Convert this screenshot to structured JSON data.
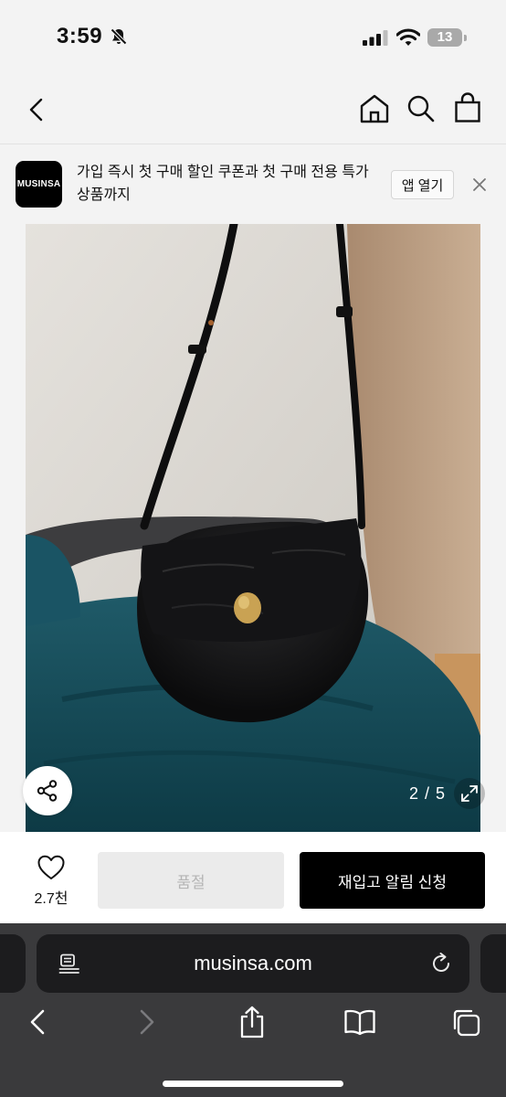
{
  "status_bar": {
    "time": "3:59",
    "battery_level": "13",
    "icons": [
      "bell-slash-icon",
      "cellular-signal-icon",
      "wifi-icon",
      "battery-icon"
    ]
  },
  "nav": {
    "icons": [
      "back-chevron-icon",
      "home-icon",
      "search-icon",
      "shopping-bag-icon"
    ]
  },
  "app_banner": {
    "logo_text": "MUSINSA",
    "promo_text": "가입 즉시 첫 구매 할인 쿠폰과 첫 구매 전용 특가 상품까지",
    "open_app_label": "앱 열기",
    "close_icon": "close-icon"
  },
  "product_image": {
    "counter": "2 / 5",
    "share_icon": "share-icon",
    "expand_icon": "expand-icon"
  },
  "action_bar": {
    "like_icon": "heart-icon",
    "like_count": "2.7천",
    "soldout_label": "품절",
    "restock_label": "재입고 알림 신청",
    "colors": {
      "primary_button": "#000000",
      "disabled_button": "#ebebeb"
    }
  },
  "safari": {
    "url": "musinsa.com",
    "toolbar_icons": [
      "back-icon",
      "forward-icon",
      "share-up-icon",
      "bookmarks-icon",
      "tabs-icon"
    ]
  }
}
